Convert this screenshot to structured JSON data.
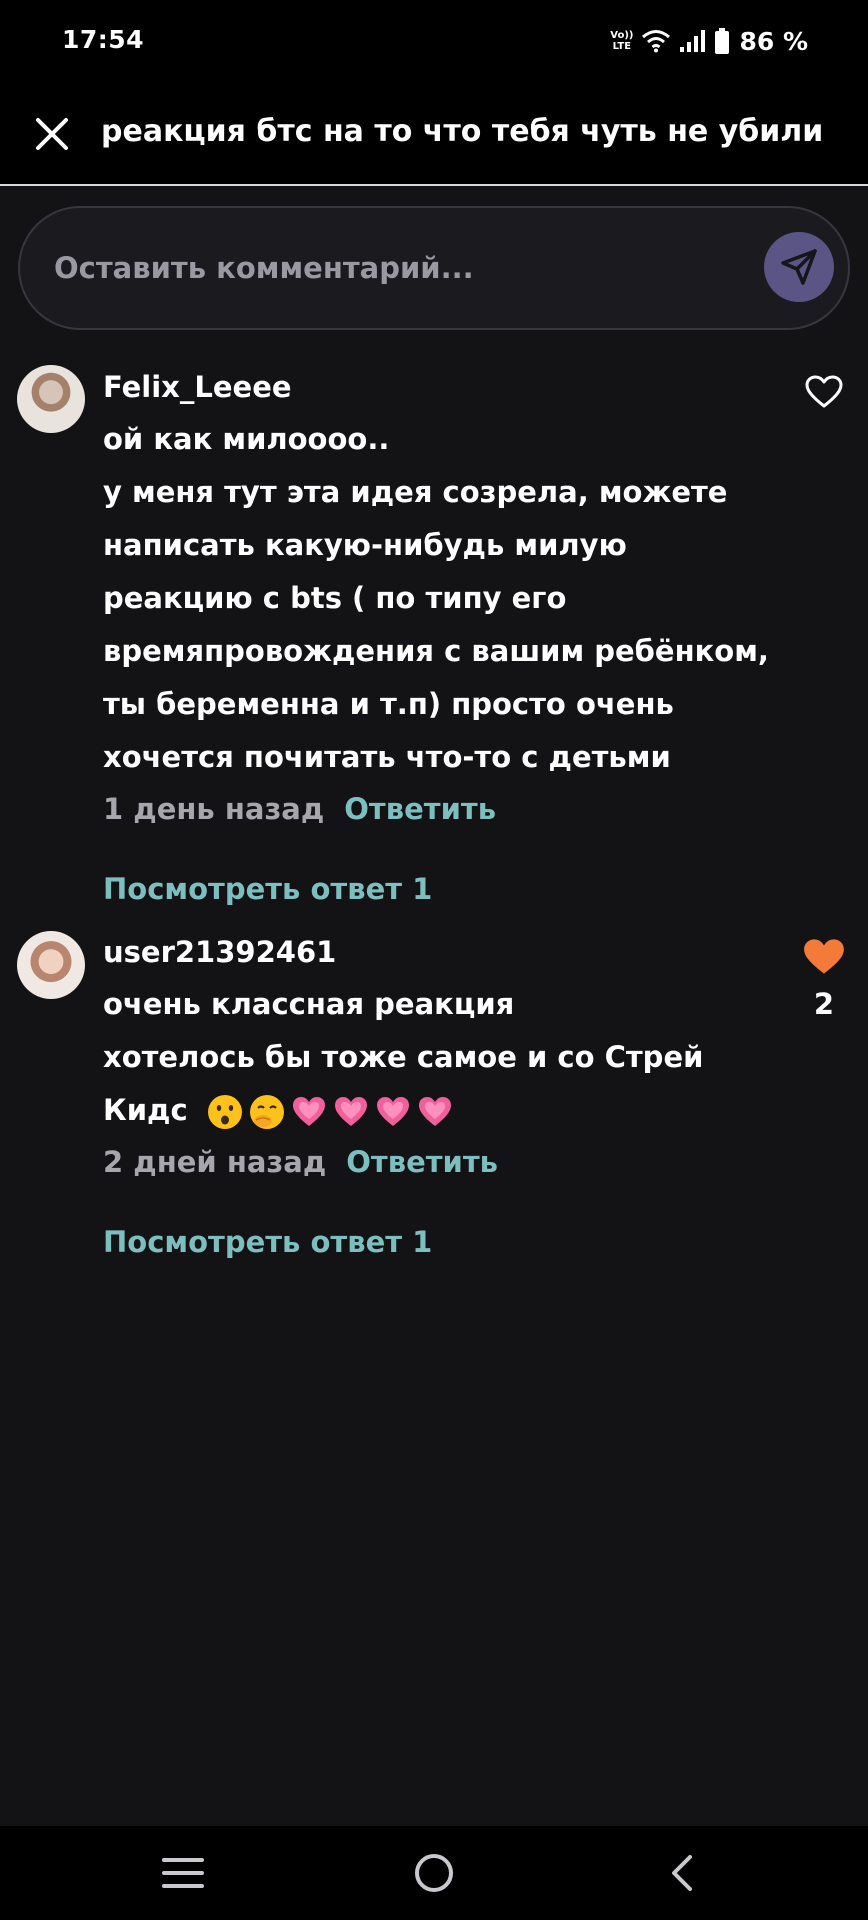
{
  "status_bar": {
    "time": "17:54",
    "volte_top": "Vo))",
    "volte_bottom": "LTE",
    "battery": "86 %"
  },
  "header": {
    "title": "реакция бтс на то что тебя чуть не убили"
  },
  "comment_input": {
    "placeholder": "Оставить комментарий..."
  },
  "comments": [
    {
      "username": "Felix_Leeee",
      "lines": [
        "ой как милоооо..",
        "у меня тут эта идея созрела, можете",
        "написать какую-нибудь милую",
        "реакцию с bts ( по типу его",
        "времяпровождения с вашим ребёнком,",
        "ты беременна и т.п) просто очень",
        "хочется почитать что-то с детьми"
      ],
      "ago": "1 день назад",
      "reply_label": "Ответить",
      "view_replies": "Посмотреть ответ 1",
      "liked": false
    },
    {
      "username": "user21392461",
      "lines": [
        "очень классная реакция",
        "хотелось бы тоже самое и со Стрей",
        "Кидс"
      ],
      "emojis": [
        "frowning-face-open-mouth",
        "hand-over-mouth",
        "growing-heart",
        "growing-heart",
        "growing-heart",
        "growing-heart"
      ],
      "ago": "2 дней назад",
      "reply_label": "Ответить",
      "view_replies": "Посмотреть ответ 1",
      "liked": true,
      "like_count": "2"
    }
  ],
  "colors": {
    "background": "#131215",
    "accent_teal": "#7dbfbe",
    "send_button": "#5b5585",
    "liked_heart": "#f47a3a"
  }
}
